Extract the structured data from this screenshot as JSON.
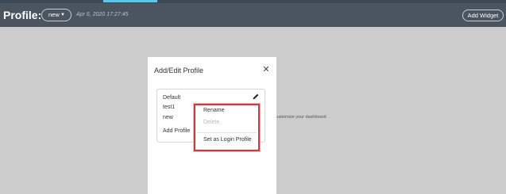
{
  "header": {
    "title": "Profile:",
    "profile_select": "new",
    "timestamp": "Apr 6, 2020 17:27:45",
    "add_widget_label": "Add Widget"
  },
  "background": {
    "hint_text": "customize your dashboard"
  },
  "modal": {
    "title": "Add/Edit Profile",
    "close_glyph": "✕",
    "profiles": [
      {
        "label": "Default"
      },
      {
        "label": "test1"
      },
      {
        "label": "new"
      }
    ],
    "add_profile_label": "Add Profile"
  },
  "context_menu": {
    "items": [
      {
        "label": "Rename",
        "enabled": true
      },
      {
        "label": "Delete",
        "enabled": false
      },
      {
        "label": "Set as Login Profile",
        "enabled": true
      }
    ]
  },
  "colors": {
    "header_bg": "#4a5560",
    "accent": "#5cc5e8",
    "highlight_border": "#d9343a",
    "page_bg": "#cccccc"
  },
  "icons": {
    "dropdown": "caret-down-icon",
    "close": "close-icon",
    "edit": "pencil-icon"
  }
}
